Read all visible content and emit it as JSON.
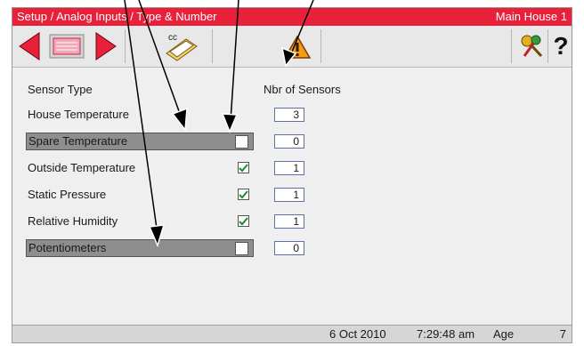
{
  "titlebar": {
    "path": "Setup / Analog Inputs / Type & Number",
    "location": "Main House 1"
  },
  "toolbar": {
    "back_icon": "left-arrow-icon",
    "list_icon": "list-icon",
    "forward_icon": "right-arrow-icon",
    "copy_badge": "cc",
    "alarm_icon": "warning-icon",
    "key_icon": "keys-icon",
    "help_label": "?"
  },
  "headers": {
    "sensor_type": "Sensor Type",
    "nbr_of_sensors": "Nbr of Sensors"
  },
  "rows": [
    {
      "label": "House Temperature",
      "checkbox": "none",
      "count": "3"
    },
    {
      "label": "Spare Temperature",
      "checkbox": "empty",
      "count": "0"
    },
    {
      "label": "Outside Temperature",
      "checkbox": "checked",
      "count": "1"
    },
    {
      "label": "Static Pressure",
      "checkbox": "checked",
      "count": "1"
    },
    {
      "label": "Relative Humidity",
      "checkbox": "checked",
      "count": "1"
    },
    {
      "label": "Potentiometers",
      "checkbox": "empty",
      "count": "0"
    }
  ],
  "status": {
    "date": "6 Oct 2010",
    "time": "7:29:48 am",
    "age_label": "Age",
    "age_value": "7"
  },
  "colors": {
    "titlebar": "#e8203a",
    "check": "#1f8a2a",
    "highlight_row": "#8e8e8e"
  }
}
